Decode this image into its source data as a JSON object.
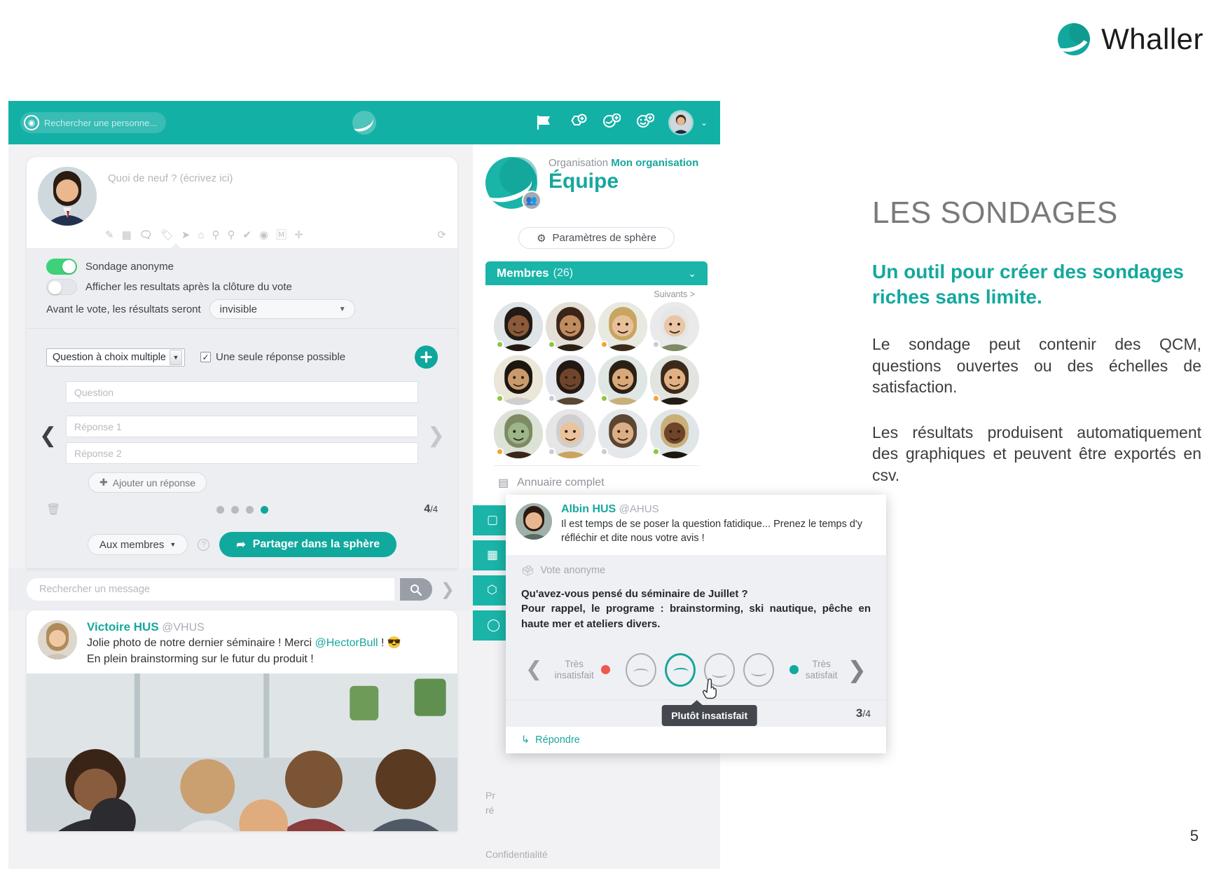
{
  "brand": {
    "name": "Whaller",
    "logo_icon": "whaller-logo-icon",
    "accent": "#13a89e"
  },
  "copy": {
    "title": "LES SONDAGES",
    "subtitle": "Un outil pour créer des sondages riches sans limite.",
    "paragraph1": "Le sondage peut contenir des QCM, questions ouvertes ou des échelles de satisfaction.",
    "paragraph2": "Les résultats produisent automatiquement des graphiques et peuvent être exportés en csv."
  },
  "page_number": "5",
  "app": {
    "topbar": {
      "search_placeholder": "Rechercher une personne...",
      "search_icon": "avatar-search-icon",
      "center_logo_icon": "whaller-logo-icon",
      "actions": [
        {
          "name": "flag-icon",
          "glyph": "⚑"
        },
        {
          "name": "add-sphere-icon",
          "glyph": "⬡"
        },
        {
          "name": "add-contact-icon",
          "glyph": "◔"
        },
        {
          "name": "add-friend-icon",
          "glyph": "☺"
        }
      ],
      "account_caret": "⌄"
    },
    "composer": {
      "placeholder": "Quoi de neuf ? (écrivez ici)",
      "tools": [
        {
          "name": "attachment-icon",
          "glyph": "✎"
        },
        {
          "name": "calendar-icon",
          "glyph": "▦"
        },
        {
          "name": "poll-icon",
          "glyph": "💬",
          "active": true
        },
        {
          "name": "tag-icon",
          "glyph": "🏷"
        },
        {
          "name": "send-icon",
          "glyph": "➤"
        },
        {
          "name": "home-icon",
          "glyph": "⌂"
        },
        {
          "name": "idea-icon",
          "glyph": "💡"
        },
        {
          "name": "location-icon",
          "glyph": "⚲"
        },
        {
          "name": "check-icon",
          "glyph": "✔"
        },
        {
          "name": "eye-icon",
          "glyph": "👁"
        },
        {
          "name": "markdown-icon",
          "glyph": "Ⓜ"
        },
        {
          "name": "plus-circle-icon",
          "glyph": "✛"
        }
      ],
      "refresh_icon": "refresh-icon",
      "anonymous_label": "Sondage anonyme",
      "anonymous_on": true,
      "show_results_label": "Afficher les resultats après la clôture du vote",
      "show_results_on": false,
      "before_vote_label": "Avant le vote, les résultats seront",
      "before_vote_value": "invisible",
      "question_type": "Question à choix multiple",
      "single_answer_label": "Une seule réponse possible",
      "single_answer_checked": true,
      "add_question_icon": "plus-icon",
      "question_placeholder": "Question",
      "answer1_placeholder": "Réponse 1",
      "answer2_placeholder": "Réponse 2",
      "add_answer_label": "Ajouter un réponse",
      "delete_icon": "trash-icon",
      "prev_icon": "chevron-left-icon",
      "next_icon": "chevron-right-icon",
      "step_dots": 4,
      "step_active": 4,
      "step_counter_current": "4",
      "step_counter_total": "/4",
      "audience_label": "Aux membres",
      "help_icon": "help-icon",
      "share_label": "Partager dans la sphère",
      "share_icon": "share-arrow-icon"
    },
    "message_search": {
      "placeholder": "Rechercher un message",
      "search_icon": "search-icon",
      "next_icon": "chevron-right-icon"
    },
    "post": {
      "author": "Victoire HUS",
      "handle": "@VHUS",
      "line1_pre": "Jolie photo de notre dernier séminaire ! Merci ",
      "mention": "@HectorBull",
      "line1_post": " ! 😎",
      "line2": "En plein brainstorming sur le futur du produit !"
    },
    "sphere": {
      "org_label": "Organisation",
      "org_name": "Mon organisation",
      "name": "Équipe",
      "settings_label": "Paramètres de sphère",
      "settings_icon": "gear-icon",
      "badge_icon": "group-icon",
      "members_label": "Membres",
      "members_count": "(26)",
      "members_chevron": "chevron-down-icon",
      "next_label": "Suivants >",
      "directory_label": "Annuaire complet",
      "directory_icon": "address-book-icon",
      "member_presence": [
        "#8cc63f",
        "#8cc63f",
        "#f2a23c",
        "#c9ccd1",
        "#8cc63f",
        "#c9ccd1",
        "#8cc63f",
        "#f2a23c",
        "#f2a23c",
        "#c9ccd1",
        "#c9ccd1",
        "#8cc63f"
      ],
      "side_buttons": [
        {
          "name": "sidebutton-documents",
          "icon": "document-icon"
        },
        {
          "name": "sidebutton-agenda",
          "icon": "calendar-icon"
        },
        {
          "name": "sidebutton-modules",
          "icon": "cube-icon"
        },
        {
          "name": "sidebutton-options",
          "icon": "circle-icon"
        }
      ],
      "bottom_note_line1": "Pr",
      "bottom_note_line2": "ré",
      "bottom_note_line3": "Confidentialité"
    },
    "poll_popup": {
      "author": "Albin HUS",
      "handle": "@AHUS",
      "intro": "Il est temps de se poser la question fatidique... Prenez le temps d'y réfléchir et dite nous votre avis !",
      "anon_label": "Vote anonyme",
      "anon_icon": "anonymous-vote-icon",
      "question_line1": "Qu'avez-vous pensé du séminaire de Juillet ?",
      "question_line2": "Pour rappel, le programe : brainstorming, ski nautique, pêche en haute mer et ateliers divers.",
      "scale_left_line1": "Très",
      "scale_left_line2": "insatisfait",
      "scale_right_line1": "Très",
      "scale_right_line2": "satisfait",
      "scale_left_color": "#f0584b",
      "scale_right_color": "#11a89e",
      "faces": [
        {
          "name": "face-very-unhappy",
          "selected": false
        },
        {
          "name": "face-unhappy",
          "selected": true
        },
        {
          "name": "face-happy",
          "selected": false
        },
        {
          "name": "face-very-happy",
          "selected": false
        }
      ],
      "tooltip": "Plutôt insatisfait",
      "cursor_icon": "pointer-cursor-icon",
      "prev_icon": "chevron-left-icon",
      "next_icon": "chevron-right-icon",
      "step_dots": 4,
      "step_active": 3,
      "counter_current": "3",
      "counter_total": "/4",
      "reply_label": "Répondre",
      "reply_icon": "reply-arrow-icon"
    }
  }
}
